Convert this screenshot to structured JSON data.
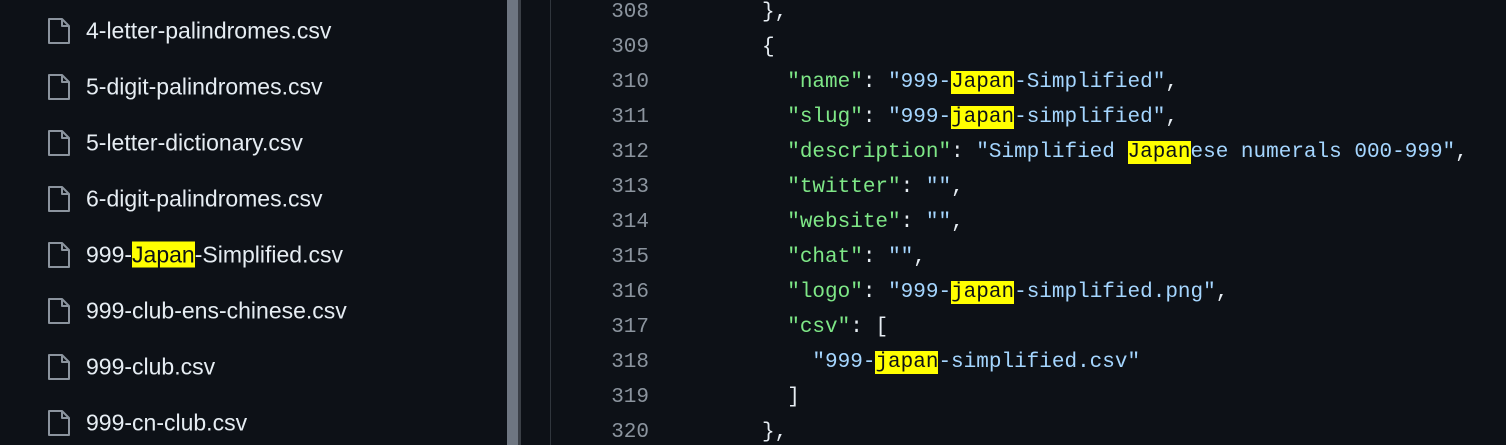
{
  "colors": {
    "background": "#0d1117",
    "text": "#e6edf3",
    "highlight": "#ffff00",
    "json_key": "#7ee787",
    "json_string": "#a5d6ff",
    "line_number": "#8b949e"
  },
  "sidebar": {
    "files": [
      {
        "icon": "file-icon",
        "pre": "4-letter-palindromes.csv",
        "hl": "",
        "post": ""
      },
      {
        "icon": "file-icon",
        "pre": "5-digit-palindromes.csv",
        "hl": "",
        "post": ""
      },
      {
        "icon": "file-icon",
        "pre": "5-letter-dictionary.csv",
        "hl": "",
        "post": ""
      },
      {
        "icon": "file-icon",
        "pre": "6-digit-palindromes.csv",
        "hl": "",
        "post": ""
      },
      {
        "icon": "file-icon",
        "pre": "999-",
        "hl": "Japan",
        "post": "-Simplified.csv"
      },
      {
        "icon": "file-icon",
        "pre": "999-club-ens-chinese.csv",
        "hl": "",
        "post": ""
      },
      {
        "icon": "file-icon",
        "pre": "999-club.csv",
        "hl": "",
        "post": ""
      },
      {
        "icon": "file-icon",
        "pre": "999-cn-club.csv",
        "hl": "",
        "post": ""
      }
    ]
  },
  "editor": {
    "lines": [
      {
        "num": "308",
        "indent": "",
        "tokens": [
          {
            "t": "p",
            "v": "},"
          }
        ]
      },
      {
        "num": "309",
        "indent": "",
        "tokens": [
          {
            "t": "p",
            "v": "{"
          }
        ]
      },
      {
        "num": "310",
        "indent": "  ",
        "tokens": [
          {
            "t": "k",
            "v": "\"name\""
          },
          {
            "t": "p",
            "v": ": "
          },
          {
            "t": "s",
            "v": "\"999-"
          },
          {
            "t": "hl",
            "v": "Japan"
          },
          {
            "t": "s",
            "v": "-Simplified\""
          },
          {
            "t": "p",
            "v": ","
          }
        ]
      },
      {
        "num": "311",
        "indent": "  ",
        "tokens": [
          {
            "t": "k",
            "v": "\"slug\""
          },
          {
            "t": "p",
            "v": ": "
          },
          {
            "t": "s",
            "v": "\"999-"
          },
          {
            "t": "hl",
            "v": "japan"
          },
          {
            "t": "s",
            "v": "-simplified\""
          },
          {
            "t": "p",
            "v": ","
          }
        ]
      },
      {
        "num": "312",
        "indent": "  ",
        "tokens": [
          {
            "t": "k",
            "v": "\"description\""
          },
          {
            "t": "p",
            "v": ": "
          },
          {
            "t": "s",
            "v": "\"Simplified "
          },
          {
            "t": "hl",
            "v": "Japan"
          },
          {
            "t": "s",
            "v": "ese numerals 000-999\""
          },
          {
            "t": "p",
            "v": ","
          }
        ]
      },
      {
        "num": "313",
        "indent": "  ",
        "tokens": [
          {
            "t": "k",
            "v": "\"twitter\""
          },
          {
            "t": "p",
            "v": ": "
          },
          {
            "t": "s",
            "v": "\"\""
          },
          {
            "t": "p",
            "v": ","
          }
        ]
      },
      {
        "num": "314",
        "indent": "  ",
        "tokens": [
          {
            "t": "k",
            "v": "\"website\""
          },
          {
            "t": "p",
            "v": ": "
          },
          {
            "t": "s",
            "v": "\"\""
          },
          {
            "t": "p",
            "v": ","
          }
        ]
      },
      {
        "num": "315",
        "indent": "  ",
        "tokens": [
          {
            "t": "k",
            "v": "\"chat\""
          },
          {
            "t": "p",
            "v": ": "
          },
          {
            "t": "s",
            "v": "\"\""
          },
          {
            "t": "p",
            "v": ","
          }
        ]
      },
      {
        "num": "316",
        "indent": "  ",
        "tokens": [
          {
            "t": "k",
            "v": "\"logo\""
          },
          {
            "t": "p",
            "v": ": "
          },
          {
            "t": "s",
            "v": "\"999-"
          },
          {
            "t": "hl",
            "v": "japan"
          },
          {
            "t": "s",
            "v": "-simplified.png\""
          },
          {
            "t": "p",
            "v": ","
          }
        ]
      },
      {
        "num": "317",
        "indent": "  ",
        "tokens": [
          {
            "t": "k",
            "v": "\"csv\""
          },
          {
            "t": "p",
            "v": ": ["
          }
        ]
      },
      {
        "num": "318",
        "indent": "    ",
        "tokens": [
          {
            "t": "s",
            "v": "\"999-"
          },
          {
            "t": "hl",
            "v": "japan"
          },
          {
            "t": "s",
            "v": "-simplified.csv\""
          }
        ]
      },
      {
        "num": "319",
        "indent": "  ",
        "tokens": [
          {
            "t": "p",
            "v": "]"
          }
        ]
      },
      {
        "num": "320",
        "indent": "",
        "tokens": [
          {
            "t": "p",
            "v": "},"
          }
        ]
      }
    ]
  }
}
